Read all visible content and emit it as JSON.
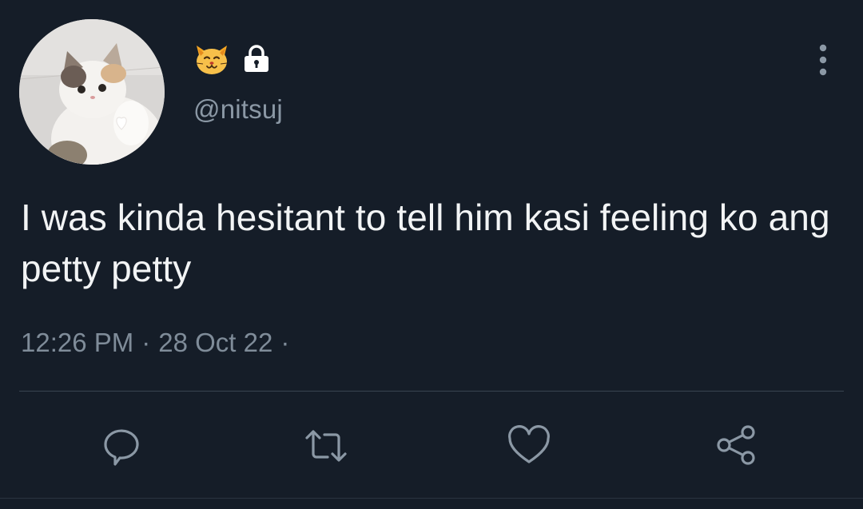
{
  "tweet": {
    "display_name_emoji": "cat-face-emoji",
    "protected": true,
    "handle": "@nitsuj",
    "text": "I was kinda hesitant to tell him kasi feeling ko ang petty petty",
    "time": "12:26 PM",
    "separator": "·",
    "date": "28 Oct 22",
    "trailing_separator": "·"
  },
  "actions": {
    "reply_icon": "speech-bubble-icon",
    "retweet_icon": "retweet-icon",
    "like_icon": "heart-icon",
    "share_icon": "share-icon"
  },
  "colors": {
    "background": "#151d28",
    "text": "#f2f4f5",
    "muted": "#8b98a5"
  }
}
